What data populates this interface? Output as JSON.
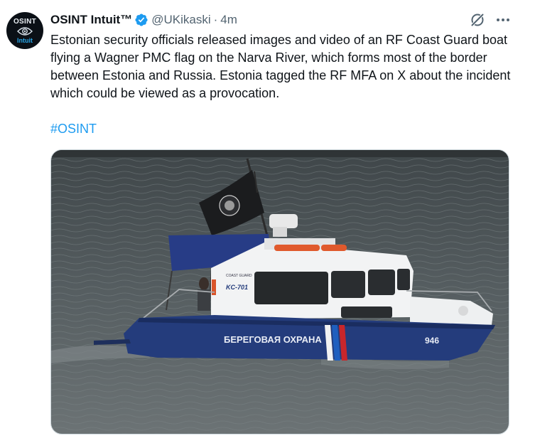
{
  "post": {
    "author_name": "OSINT Intuit™",
    "author_handle": "@UKikaski",
    "separator": "·",
    "time": "4m",
    "text": "Estonian security officials released images and video of an RF Coast Guard boat flying a Wagner PMC flag on the Narva River, which forms most of the border between Estonia and Russia. Estonia tagged the RF MFA on X about the incident which could be viewed as a provocation.",
    "hashtag": "#OSINT"
  },
  "avatar": {
    "top_text": "OSINT",
    "bottom_text": "Intuit"
  },
  "media": {
    "boat_text": "БЕРЕГОВАЯ ОХРАНА",
    "hull_number": "946",
    "cabin_label": "COAST GUARD",
    "cabin_id": "KC-701"
  },
  "icons": {
    "verified": "verified-badge-icon",
    "grok": "grok-icon",
    "more": "more-icon"
  },
  "colors": {
    "link": "#1d9bf0",
    "verified": "#1d9bf0",
    "secondary_text": "#536471"
  }
}
